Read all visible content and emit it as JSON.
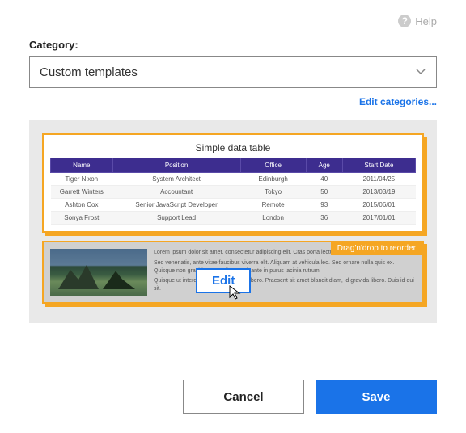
{
  "help": {
    "label": "Help"
  },
  "category": {
    "label": "Category:",
    "selected": "Custom templates",
    "edit_link": "Edit categories..."
  },
  "template1": {
    "title": "Simple data table",
    "headers": {
      "name": "Name",
      "position": "Position",
      "office": "Office",
      "age": "Age",
      "date": "Start Date"
    },
    "rows": [
      {
        "name": "Tiger Nixon",
        "position": "System Architect",
        "office": "Edinburgh",
        "age": "40",
        "date": "2011/04/25"
      },
      {
        "name": "Garrett Winters",
        "position": "Accountant",
        "office": "Tokyo",
        "age": "50",
        "date": "2013/03/19"
      },
      {
        "name": "Ashton Cox",
        "position": "Senior JavaScript Developer",
        "office": "Remote",
        "age": "93",
        "date": "2015/06/01"
      },
      {
        "name": "Sonya Frost",
        "position": "Support Lead",
        "office": "London",
        "age": "36",
        "date": "2017/01/01"
      }
    ]
  },
  "template2": {
    "reorder_hint": "Drag'n'drop to reorder",
    "edit_button": "Edit",
    "paragraphs": [
      "Lorem ipsum dolor sit amet, consectetur adipiscing elit. Cras porta lectus eget elit commodo commodo.",
      "Sed venenatis, ante vitae faucibus viverra elit. Aliquam at vehicula leo. Sed ornare nulla quis ex. Quisque non gravida urna. Aliquam sit ante in purus lacinia rutrum.",
      "Quisque ut interdum leo, non congue libero. Praesent sit amet blandit diam, id gravida libero. Duis id dui sit.",
      ""
    ]
  },
  "footer": {
    "cancel": "Cancel",
    "save": "Save"
  }
}
